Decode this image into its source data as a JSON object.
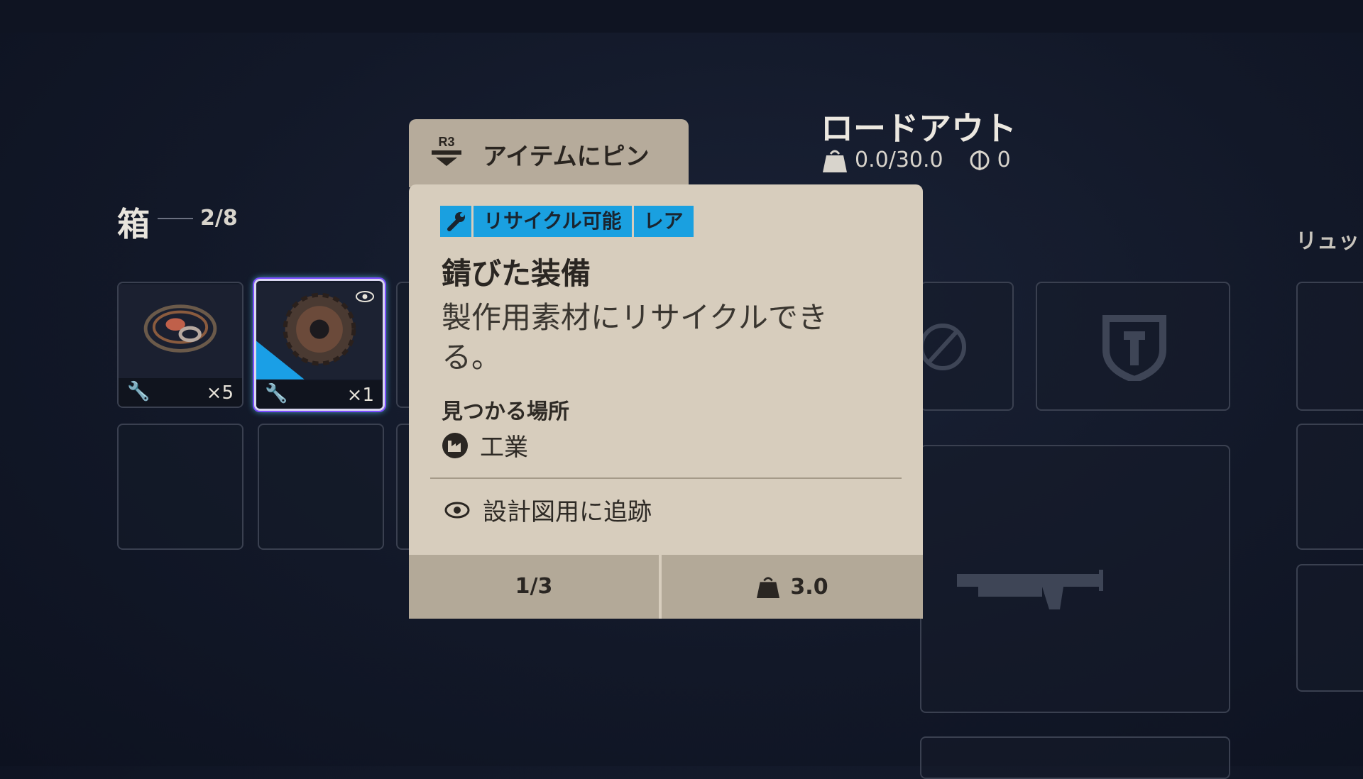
{
  "crate": {
    "title": "箱",
    "count": "2/8"
  },
  "slots": [
    {
      "name": "wire-spool-item",
      "qty": "×5",
      "has_eye": false
    },
    {
      "name": "rusted-gear-item",
      "qty": "×1",
      "has_eye": true
    }
  ],
  "loadout": {
    "title": "ロードアウト",
    "weight": "0.0/30.0",
    "currency": "0"
  },
  "backpack": {
    "label": "リュッ"
  },
  "tooltip": {
    "pin_button": "R3",
    "pin_label": "アイテムにピン",
    "tags": [
      "リサイクル可能",
      "レア"
    ],
    "item_name": "錆びた装備",
    "description": "製作用素材にリサイクルできる。",
    "found_label": "見つかる場所",
    "found_value": "工業",
    "track_label": "設計図用に追跡",
    "page": "1/3",
    "weight": "3.0"
  },
  "colors": {
    "rarity_tag": "#1aa0e0",
    "card_bg": "#d7cdbd",
    "card_footer": "#b3a998",
    "selection_glow": "#7b4dff"
  }
}
